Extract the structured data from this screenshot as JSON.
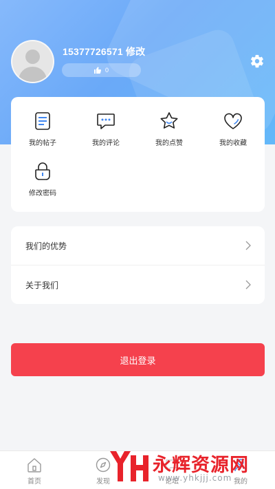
{
  "profile": {
    "username": "15377726571 修改",
    "likes": "0",
    "avatar_icon": "default-avatar-icon",
    "settings_icon": "gear-icon"
  },
  "grid": {
    "items": [
      {
        "label": "我的帖子",
        "icon": "document-icon"
      },
      {
        "label": "我的评论",
        "icon": "comment-icon"
      },
      {
        "label": "我的点赞",
        "icon": "star-icon"
      },
      {
        "label": "我的收藏",
        "icon": "heart-icon"
      },
      {
        "label": "修改密码",
        "icon": "lock-icon"
      }
    ]
  },
  "list": {
    "items": [
      {
        "label": "我们的优势"
      },
      {
        "label": "关于我们"
      }
    ]
  },
  "logout_label": "退出登录",
  "tabbar": {
    "tabs": [
      {
        "label": "首页",
        "icon": "home-icon"
      },
      {
        "label": "发现",
        "icon": "compass-icon"
      },
      {
        "label": "论坛",
        "icon": "forum-icon"
      },
      {
        "label": "我的",
        "icon": "user-icon"
      }
    ]
  },
  "watermark": {
    "text": "永辉资源网",
    "url": "www.yhkjjj.com"
  },
  "colors": {
    "accent_blue": "#6aa9f8",
    "logout_red": "#f5414d",
    "icon_blue": "#3f86f0"
  }
}
